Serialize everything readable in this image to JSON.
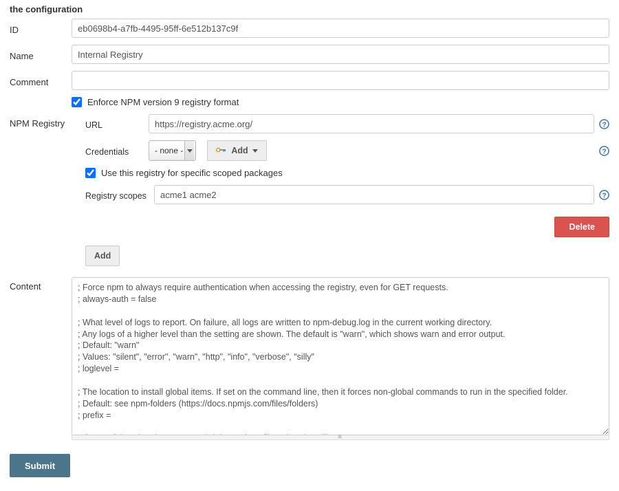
{
  "header": "the configuration",
  "fields": {
    "id_label": "ID",
    "id_value": "eb0698b4-a7fb-4495-95ff-6e512b137c9f",
    "name_label": "Name",
    "name_value": "Internal Registry",
    "comment_label": "Comment",
    "comment_value": ""
  },
  "registry": {
    "enforce_label": "Enforce NPM version 9 registry format",
    "enforce_checked": true,
    "section_label": "NPM Registry",
    "url_label": "URL",
    "url_value": "https://registry.acme.org/",
    "creds_label": "Credentials",
    "creds_value": "- none -",
    "add_label": "Add",
    "scoped_checked": true,
    "scoped_label": "Use this registry for specific scoped packages",
    "scopes_label": "Registry scopes",
    "scopes_value": "acme1 acme2",
    "delete_label": "Delete",
    "add_btn_label": "Add"
  },
  "content": {
    "label": "Content",
    "value": "; Force npm to always require authentication when accessing the registry, even for GET requests.\n; always-auth = false\n\n; What level of logs to report. On failure, all logs are written to npm-debug.log in the current working directory.\n; Any logs of a higher level than the setting are shown. The default is \"warn\", which shows warn and error output.\n; Default: \"warn\"\n; Values: \"silent\", \"error\", \"warn\", \"http\", \"info\", \"verbose\", \"silly\"\n; loglevel =\n\n; The location to install global items. If set on the command line, then it forces non-global commands to run in the specified folder.\n; Default: see npm-folders (https://docs.npmjs.com/files/folders)\n; prefix =\n\n; If set to false, then ignore npm-shrinkwrap.json files when installing.\n; Default: true\n; shrinkwrap ="
  },
  "submit_label": "Submit"
}
